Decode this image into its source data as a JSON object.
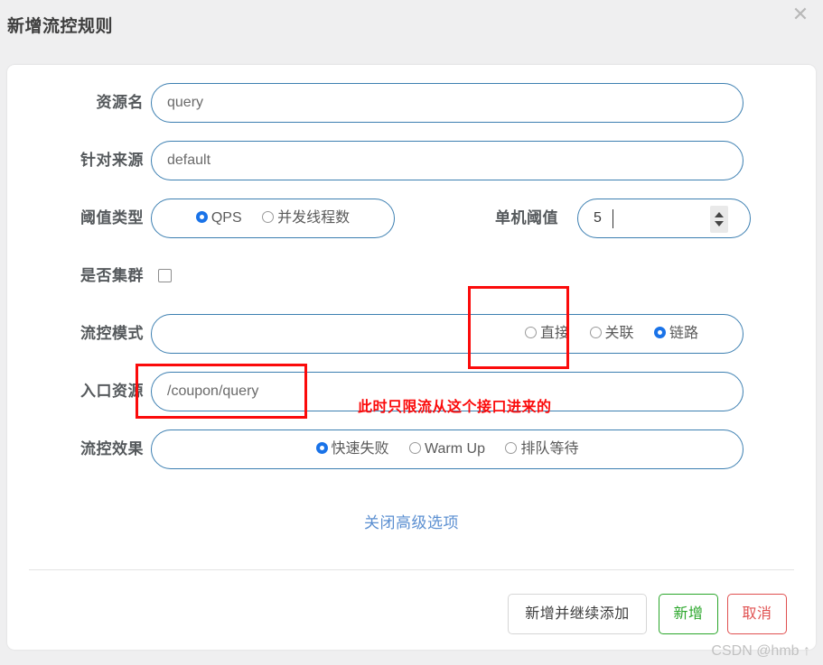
{
  "dialog": {
    "title": "新增流控规则",
    "close_icon": "close-icon"
  },
  "form": {
    "rows": [
      {
        "label": "资源名",
        "value": "query"
      },
      {
        "label": "针对来源",
        "value": "default"
      }
    ],
    "threshold_type": {
      "label": "阈值类型",
      "options": [
        {
          "label": "QPS",
          "checked": true
        },
        {
          "label": "并发线程数",
          "checked": false
        }
      ]
    },
    "single_threshold": {
      "label": "单机阈值",
      "value": "5",
      "spinner_up_icon": "arrow-up-icon",
      "spinner_down_icon": "arrow-down-icon"
    },
    "cluster": {
      "label": "是否集群",
      "checked": false
    },
    "flow_mode": {
      "label": "流控模式",
      "options": [
        {
          "label": "直接",
          "checked": false
        },
        {
          "label": "关联",
          "checked": false
        },
        {
          "label": "链路",
          "checked": true
        }
      ]
    },
    "entry_resource": {
      "label": "入口资源",
      "value": "/coupon/query"
    },
    "flow_effect": {
      "label": "流控效果",
      "options": [
        {
          "label": "快速失败",
          "checked": true
        },
        {
          "label": "Warm Up",
          "checked": false
        },
        {
          "label": "排队等待",
          "checked": false
        }
      ]
    },
    "advanced_toggle": "关闭高级选项"
  },
  "footer": {
    "add_continue_label": "新增并继续添加",
    "add_label": "新增",
    "cancel_label": "取消"
  },
  "annotations": {
    "note_text": "此时只限流从这个接口进来的",
    "color": "#fb0b0b"
  },
  "watermark": "CSDN @hmb ↑"
}
